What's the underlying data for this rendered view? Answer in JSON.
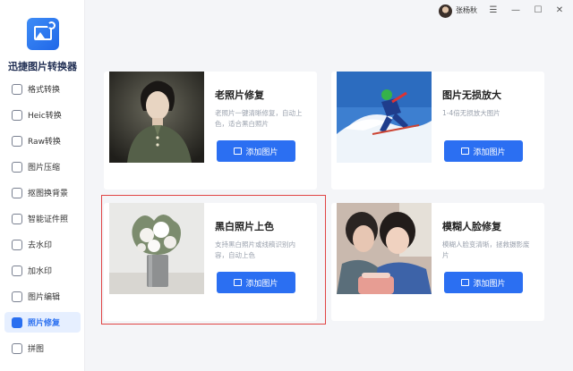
{
  "app": {
    "name": "迅捷图片转换器"
  },
  "titlebar": {
    "username": "张杨秋",
    "menu_icon": "menu-icon",
    "min_icon": "minimize-icon",
    "max_icon": "maximize-icon",
    "close_icon": "close-icon"
  },
  "sidebar": {
    "items": [
      {
        "label": "格式转换",
        "icon": "format-convert-icon"
      },
      {
        "label": "Heic转换",
        "icon": "heic-icon"
      },
      {
        "label": "Raw转换",
        "icon": "raw-icon"
      },
      {
        "label": "图片压缩",
        "icon": "compress-icon"
      },
      {
        "label": "抠图换背景",
        "icon": "cutout-icon"
      },
      {
        "label": "智能证件照",
        "icon": "id-photo-icon"
      },
      {
        "label": "去水印",
        "icon": "remove-watermark-icon"
      },
      {
        "label": "加水印",
        "icon": "add-watermark-icon"
      },
      {
        "label": "图片编辑",
        "icon": "edit-icon"
      },
      {
        "label": "照片修复",
        "icon": "photo-repair-icon",
        "active": true
      },
      {
        "label": "拼图",
        "icon": "collage-icon"
      }
    ]
  },
  "cards": [
    {
      "title": "老照片修复",
      "desc": "老照片一键清晰修复，自动上色，适合黑白照片",
      "button": "添加图片"
    },
    {
      "title": "图片无损放大",
      "desc": "1-4倍无损放大图片",
      "button": "添加图片"
    },
    {
      "title": "黑白照片上色",
      "desc": "支持黑白照片或线稿识别内容，自动上色",
      "button": "添加图片"
    },
    {
      "title": "模糊人脸修复",
      "desc": "模糊人脸变清晰，拯救摄影废片",
      "button": "添加图片"
    }
  ],
  "colors": {
    "accent": "#2b6ff2",
    "highlight": "#e04545",
    "active_bg": "#e6efff"
  }
}
